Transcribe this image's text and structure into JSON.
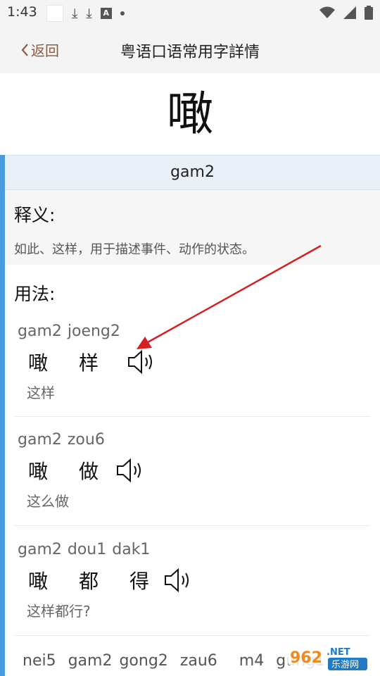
{
  "status": {
    "time": "1:43"
  },
  "header": {
    "back_label": "返回",
    "title": "粤语口语常用字詳情"
  },
  "word": {
    "character": "噉",
    "jyutping": "gam2"
  },
  "definition": {
    "heading": "释义:",
    "text": "如此、这样，用于描述事件、动作的状态。"
  },
  "usage": {
    "heading": "用法:",
    "examples": [
      {
        "jyutping": [
          "gam2",
          "joeng2"
        ],
        "chars": [
          "噉",
          "样"
        ],
        "meaning": "这样"
      },
      {
        "jyutping": [
          "gam2",
          "zou6"
        ],
        "chars": [
          "噉",
          "做"
        ],
        "meaning": "这么做"
      },
      {
        "jyutping": [
          "gam2",
          "dou1",
          "dak1"
        ],
        "chars": [
          "噉",
          "都",
          "得"
        ],
        "meaning": "这样都行?"
      },
      {
        "jyutping": [
          "nei5",
          "gam2",
          "gong2",
          "zau6",
          "m4",
          "gung1"
        ]
      }
    ]
  },
  "watermark": {
    "text1": "962",
    "text2": ".NET",
    "text3": "乐游网"
  },
  "colors": {
    "accent": "#4a9ae0",
    "back": "#8a5a44",
    "arrow": "#d42020"
  },
  "icons": [
    "chevron-left-icon",
    "speaker-icon",
    "wifi-icon",
    "signal-icon",
    "battery-icon",
    "download-icon"
  ]
}
